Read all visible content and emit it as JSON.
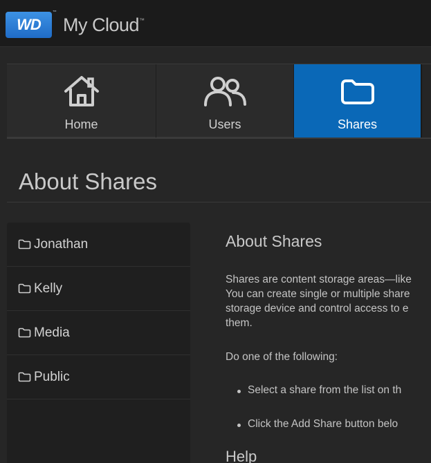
{
  "header": {
    "logo_text": "WD",
    "logo_mark": "™",
    "app_title": "My Cloud",
    "app_title_mark": "™"
  },
  "nav": [
    {
      "label": "Home",
      "icon": "home-icon",
      "active": false
    },
    {
      "label": "Users",
      "icon": "users-icon",
      "active": false
    },
    {
      "label": "Shares",
      "icon": "folder-icon",
      "active": true
    }
  ],
  "page": {
    "title": "About Shares"
  },
  "shares": [
    {
      "name": "Jonathan",
      "icon": "folder-icon"
    },
    {
      "name": "Kelly",
      "icon": "folder-icon"
    },
    {
      "name": "Media",
      "icon": "folder-icon"
    },
    {
      "name": "Public",
      "icon": "folder-icon"
    }
  ],
  "help": {
    "heading": "About Shares",
    "para1_line1": "Shares are content storage areas—like",
    "para1_line2": "You can create single or multiple share",
    "para1_line3": "storage device and control access to e",
    "para1_line4": "them.",
    "para2": "Do one of the following:",
    "bullets": [
      "Select a share from the list on th",
      "Click the Add Share button belo"
    ],
    "subheading": "Help"
  },
  "colors": {
    "accent": "#0a68b7",
    "background": "#262626",
    "header_bg": "#1b1b1b",
    "list_bg": "#1f1f1f"
  }
}
